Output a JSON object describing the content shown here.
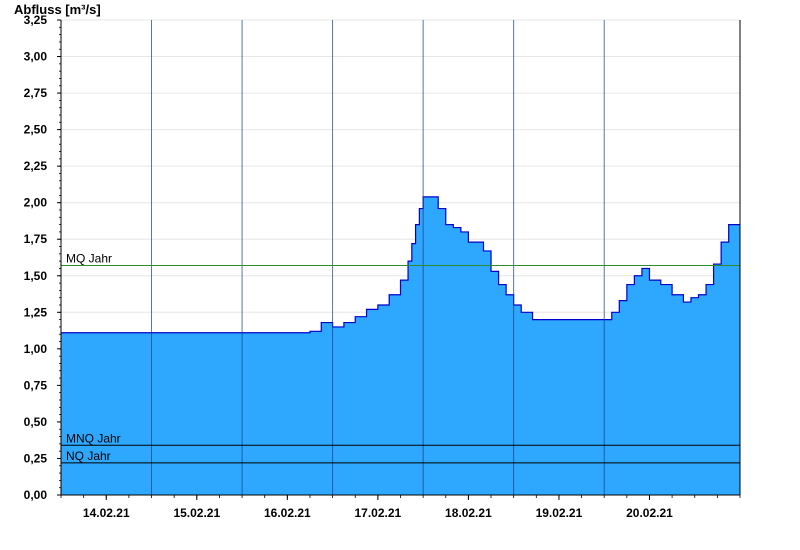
{
  "chart_data": {
    "type": "area",
    "ylabel": "Abfluss [m³/s]",
    "ylim": [
      0,
      3.25
    ],
    "yticks": [
      {
        "value": 0.0,
        "label": "0,00"
      },
      {
        "value": 0.25,
        "label": "0,25"
      },
      {
        "value": 0.5,
        "label": "0,50"
      },
      {
        "value": 0.75,
        "label": "0,75"
      },
      {
        "value": 1.0,
        "label": "1,00"
      },
      {
        "value": 1.25,
        "label": "1,25"
      },
      {
        "value": 1.5,
        "label": "1,50"
      },
      {
        "value": 1.75,
        "label": "1,75"
      },
      {
        "value": 2.0,
        "label": "2,00"
      },
      {
        "value": 2.25,
        "label": "2,25"
      },
      {
        "value": 2.5,
        "label": "2,50"
      },
      {
        "value": 2.75,
        "label": "2,75"
      },
      {
        "value": 3.0,
        "label": "3,00"
      },
      {
        "value": 3.25,
        "label": "3,25"
      }
    ],
    "xlim": [
      "2021-02-13T12:00",
      "2021-02-20T12:00"
    ],
    "xticks": [
      {
        "date": "2021-02-14T00:00",
        "label": "14.02.21"
      },
      {
        "date": "2021-02-15T00:00",
        "label": "15.02.21"
      },
      {
        "date": "2021-02-16T00:00",
        "label": "16.02.21"
      },
      {
        "date": "2021-02-17T00:00",
        "label": "17.02.21"
      },
      {
        "date": "2021-02-18T00:00",
        "label": "18.02.21"
      },
      {
        "date": "2021-02-19T00:00",
        "label": "19.02.21"
      },
      {
        "date": "2021-02-20T00:00",
        "label": "20.02.21"
      }
    ],
    "day_separators": [
      "2021-02-14T12:00",
      "2021-02-15T12:00",
      "2021-02-16T12:00",
      "2021-02-17T12:00",
      "2021-02-18T12:00",
      "2021-02-19T12:00"
    ],
    "grid": true,
    "reference_lines": [
      {
        "label": "MQ Jahr",
        "value": 1.57,
        "color": "#2e8b2e"
      },
      {
        "label": "MNQ Jahr",
        "value": 0.34,
        "color": "#000000"
      },
      {
        "label": "NQ Jahr",
        "value": 0.22,
        "color": "#000000"
      }
    ],
    "series": [
      {
        "fill": "#2ea8ff",
        "stroke": "#0000cc",
        "points": [
          [
            "2021-02-13T12:00",
            1.11
          ],
          [
            "2021-02-16T00:00",
            1.11
          ],
          [
            "2021-02-16T06:00",
            1.12
          ],
          [
            "2021-02-16T09:00",
            1.18
          ],
          [
            "2021-02-16T12:00",
            1.15
          ],
          [
            "2021-02-16T15:00",
            1.18
          ],
          [
            "2021-02-16T18:00",
            1.22
          ],
          [
            "2021-02-16T21:00",
            1.27
          ],
          [
            "2021-02-17T00:00",
            1.3
          ],
          [
            "2021-02-17T03:00",
            1.37
          ],
          [
            "2021-02-17T06:00",
            1.47
          ],
          [
            "2021-02-17T08:00",
            1.6
          ],
          [
            "2021-02-17T09:00",
            1.72
          ],
          [
            "2021-02-17T10:00",
            1.85
          ],
          [
            "2021-02-17T11:00",
            1.96
          ],
          [
            "2021-02-17T12:00",
            2.04
          ],
          [
            "2021-02-17T14:00",
            2.04
          ],
          [
            "2021-02-17T16:00",
            1.96
          ],
          [
            "2021-02-17T18:00",
            1.85
          ],
          [
            "2021-02-17T20:00",
            1.83
          ],
          [
            "2021-02-17T22:00",
            1.8
          ],
          [
            "2021-02-18T00:00",
            1.73
          ],
          [
            "2021-02-18T02:00",
            1.73
          ],
          [
            "2021-02-18T04:00",
            1.67
          ],
          [
            "2021-02-18T06:00",
            1.53
          ],
          [
            "2021-02-18T08:00",
            1.44
          ],
          [
            "2021-02-18T10:00",
            1.37
          ],
          [
            "2021-02-18T12:00",
            1.3
          ],
          [
            "2021-02-18T14:00",
            1.25
          ],
          [
            "2021-02-18T17:00",
            1.2
          ],
          [
            "2021-02-19T00:00",
            1.2
          ],
          [
            "2021-02-19T12:00",
            1.2
          ],
          [
            "2021-02-19T14:00",
            1.25
          ],
          [
            "2021-02-19T16:00",
            1.33
          ],
          [
            "2021-02-19T18:00",
            1.44
          ],
          [
            "2021-02-19T20:00",
            1.5
          ],
          [
            "2021-02-19T22:00",
            1.55
          ],
          [
            "2021-02-20T00:00",
            1.47
          ],
          [
            "2021-02-20T03:00",
            1.44
          ],
          [
            "2021-02-20T06:00",
            1.37
          ],
          [
            "2021-02-20T09:00",
            1.32
          ],
          [
            "2021-02-20T11:00",
            1.35
          ],
          [
            "2021-02-20T13:00",
            1.37
          ],
          [
            "2021-02-20T15:00",
            1.44
          ],
          [
            "2021-02-20T17:00",
            1.58
          ],
          [
            "2021-02-20T19:00",
            1.73
          ],
          [
            "2021-02-20T21:00",
            1.85
          ],
          [
            "2021-02-21T00:00",
            1.85
          ]
        ]
      }
    ]
  }
}
